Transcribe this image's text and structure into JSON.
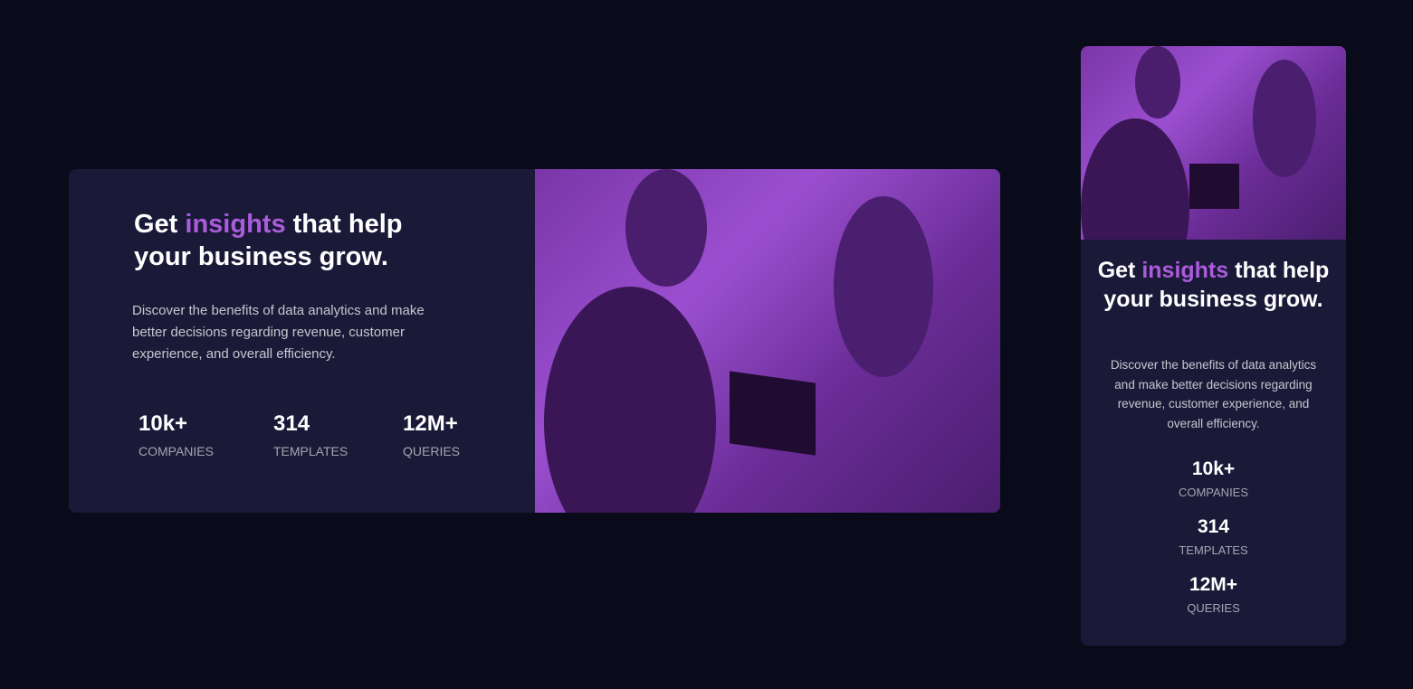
{
  "card": {
    "heading": {
      "before": "Get ",
      "highlight": "insights",
      "after": " that help your business grow."
    },
    "description": "Discover the benefits of data analytics and make better decisions regarding revenue, customer experience, and overall efficiency.",
    "stats": [
      {
        "value": "10k+",
        "label": "Companies"
      },
      {
        "value": "314",
        "label": "Templates"
      },
      {
        "value": "12M+",
        "label": "Queries"
      }
    ],
    "image": "office-photo-purple-overlay"
  },
  "colors": {
    "background": "#090b1a",
    "card": "#1b1938",
    "accent": "#aa5cdb"
  }
}
